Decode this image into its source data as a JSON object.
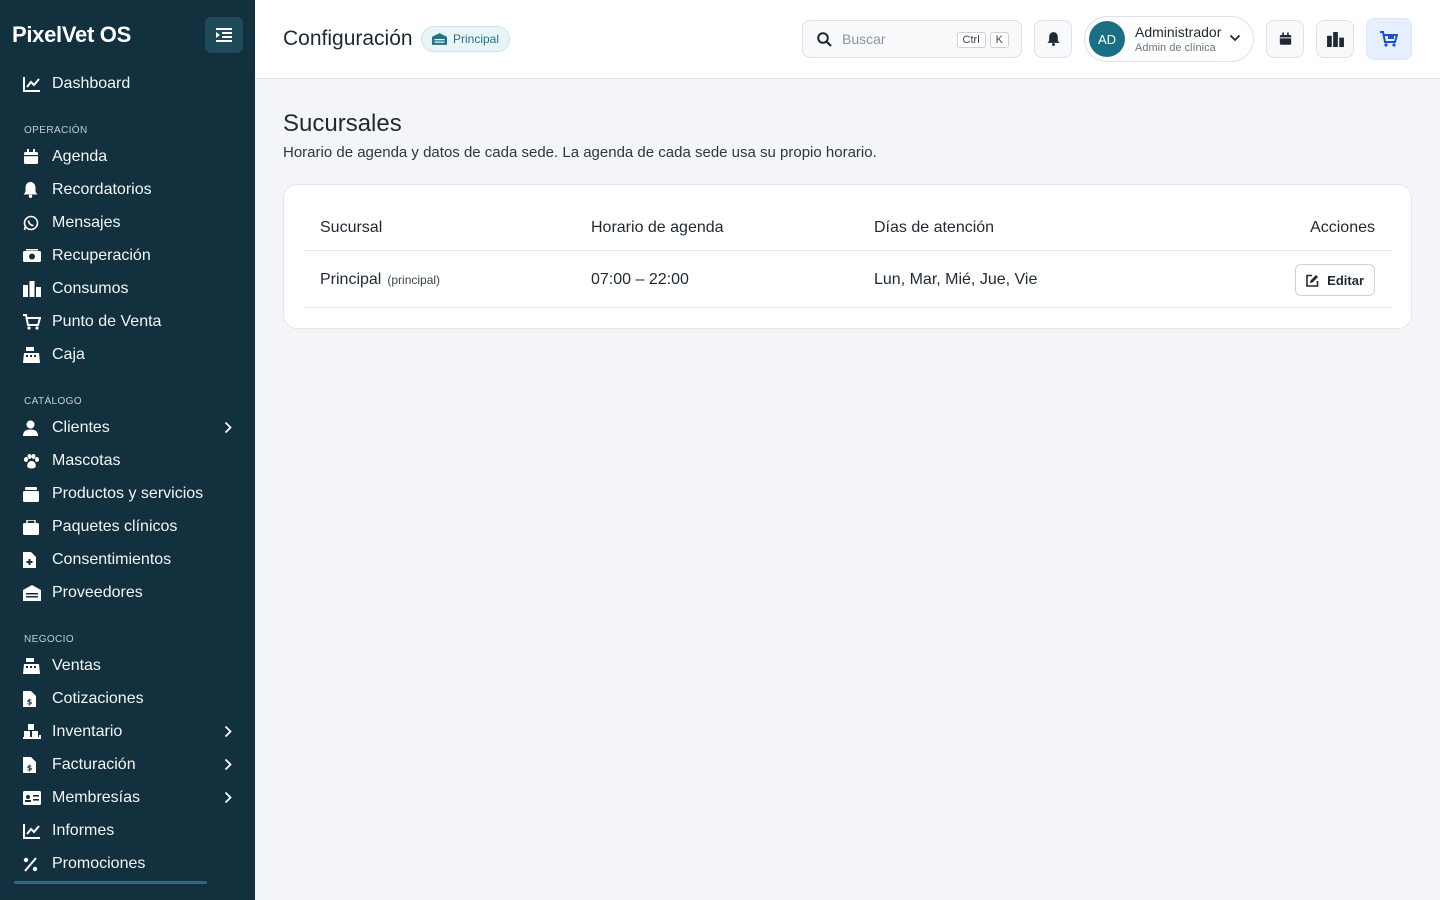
{
  "app": {
    "brand": "PixelVet OS"
  },
  "sidebar": {
    "top": {
      "label": "Dashboard"
    },
    "sections": {
      "operacion": "OPERACIÓN",
      "catalogo": "CATÁLOGO",
      "negocio": "NEGOCIO"
    },
    "items": [
      {
        "label": "Agenda",
        "icon": "calendar-icon"
      },
      {
        "label": "Recordatorios",
        "icon": "bell-icon"
      },
      {
        "label": "Mensajes",
        "icon": "whatsapp-icon"
      },
      {
        "label": "Recuperación",
        "icon": "money-icon"
      },
      {
        "label": "Consumos",
        "icon": "consumption-icon"
      },
      {
        "label": "Punto de Venta",
        "icon": "cart-icon"
      },
      {
        "label": "Caja",
        "icon": "cash-register-icon"
      },
      {
        "label": "Clientes",
        "icon": "user-icon"
      },
      {
        "label": "Mascotas",
        "icon": "paw-icon"
      },
      {
        "label": "Productos y servicios",
        "icon": "box-icon"
      },
      {
        "label": "Paquetes clínicos",
        "icon": "package-icon"
      },
      {
        "label": "Consentimientos",
        "icon": "file-medical-icon"
      },
      {
        "label": "Proveedores",
        "icon": "warehouse-icon"
      },
      {
        "label": "Ventas",
        "icon": "cash-register-icon"
      },
      {
        "label": "Cotizaciones",
        "icon": "invoice-icon"
      },
      {
        "label": "Inventario",
        "icon": "dolly-icon"
      },
      {
        "label": "Facturación",
        "icon": "invoice-icon"
      },
      {
        "label": "Membresías",
        "icon": "id-card-icon"
      },
      {
        "label": "Informes",
        "icon": "chart-line-icon"
      },
      {
        "label": "Promociones",
        "icon": "percent-icon"
      }
    ]
  },
  "header": {
    "title": "Configuración",
    "branch_badge": "Principal",
    "search": {
      "placeholder": "Buscar",
      "shortcut_1": "Ctrl",
      "shortcut_2": "K"
    },
    "user": {
      "initials": "AD",
      "name": "Administrador",
      "role": "Admin de clínica"
    }
  },
  "content": {
    "title": "Sucursales",
    "subtitle": "Horario de agenda y datos de cada sede. La agenda de cada sede usa su propio horario.",
    "table": {
      "headers": [
        "Sucursal",
        "Horario de agenda",
        "Días de atención",
        "Acciones"
      ],
      "rows": [
        {
          "name": "Principal",
          "tag": "(principal)",
          "schedule": "07:00 – 22:00",
          "days": "Lun, Mar, Mié, Jue, Vie",
          "action": "Editar"
        }
      ]
    }
  },
  "colors": {
    "sidebar_bg": "#12303d",
    "accent": "#1b6f84",
    "page_bg": "#f3f5f8"
  }
}
